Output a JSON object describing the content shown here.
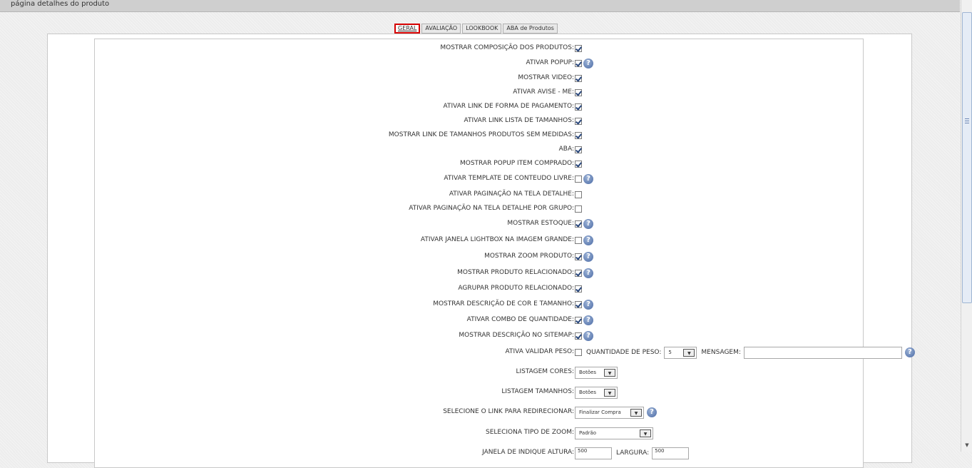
{
  "header": {
    "title": "página detalhes do produto"
  },
  "tabs": [
    {
      "label": "GERAL",
      "active": true
    },
    {
      "label": "AVALIAÇÃO"
    },
    {
      "label": "LOOKBOOK"
    },
    {
      "label": "ABA de Produtos"
    }
  ],
  "rows": [
    {
      "label": "MOSTRAR COMPOSIÇÃO DOS PRODUTOS:",
      "checked": true,
      "help": false
    },
    {
      "label": "ATIVAR POPUP:",
      "checked": true,
      "help": true
    },
    {
      "label": "MOSTRAR VIDEO:",
      "checked": true,
      "help": false
    },
    {
      "label": "ATIVAR AVISE - ME:",
      "checked": true,
      "help": false
    },
    {
      "label": "ATIVAR LINK DE FORMA DE PAGAMENTO:",
      "checked": true,
      "help": false
    },
    {
      "label": "ATIVAR LINK LISTA DE TAMANHOS:",
      "checked": true,
      "help": false
    },
    {
      "label": "MOSTRAR LINK DE TAMANHOS PRODUTOS SEM MEDIDAS:",
      "checked": true,
      "help": false
    },
    {
      "label": "ABA:",
      "checked": true,
      "help": false
    },
    {
      "label": "MOSTRAR POPUP ITEM COMPRADO:",
      "checked": true,
      "help": false
    },
    {
      "label": "ATIVAR TEMPLATE DE CONTEUDO LIVRE:",
      "checked": false,
      "help": true
    },
    {
      "label": "ATIVAR PAGINAÇÃO NA TELA DETALHE:",
      "checked": false,
      "help": false
    },
    {
      "label": "ATIVAR PAGINAÇÃO NA TELA DETALHE POR GRUPO:",
      "checked": false,
      "help": false
    },
    {
      "label": "MOSTRAR ESTOQUE:",
      "checked": true,
      "help": true
    },
    {
      "label": "ATIVAR JANELA LIGHTBOX NA IMAGEM GRANDE:",
      "checked": false,
      "help": true
    },
    {
      "label": "MOSTRAR ZOOM PRODUTO:",
      "checked": true,
      "help": true
    },
    {
      "label": "MOSTRAR PRODUTO RELACIONADO:",
      "checked": true,
      "help": true
    },
    {
      "label": "AGRUPAR PRODUTO RELACIONADO:",
      "checked": true,
      "help": false
    },
    {
      "label": "MOSTRAR DESCRIÇÃO DE COR E TAMANHO:",
      "checked": true,
      "help": true
    },
    {
      "label": "ATIVAR COMBO DE QUANTIDADE:",
      "checked": true,
      "help": true
    },
    {
      "label": "MOSTRAR DESCRIÇÃO NO SITEMAP:",
      "checked": true,
      "help": true
    }
  ],
  "peso": {
    "label": "ATIVA VALIDAR PESO:",
    "checked": false,
    "qty_label": "QUANTIDADE DE PESO:",
    "qty_value": "5",
    "msg_label": "MENSAGEM:",
    "msg_value": ""
  },
  "selects": [
    {
      "label": "LISTAGEM CORES:",
      "value": "Botões",
      "width": 60,
      "help": false
    },
    {
      "label": "LISTAGEM TAMANHOS:",
      "value": "Botões",
      "width": 60,
      "help": false
    },
    {
      "label": "SELECIONE O LINK PARA REDIRECIONAR:",
      "value": "Finalizar Compra",
      "width": 97,
      "help": true
    },
    {
      "label": "SELECIONA TIPO DE ZOOM:",
      "value": "Padrão",
      "width": 110,
      "help": false
    }
  ],
  "last_row": {
    "label": "JANELA DE INDIQUE ALTURA:",
    "height_value": "500",
    "width_label": "LARGURA:",
    "width_value": "500"
  }
}
